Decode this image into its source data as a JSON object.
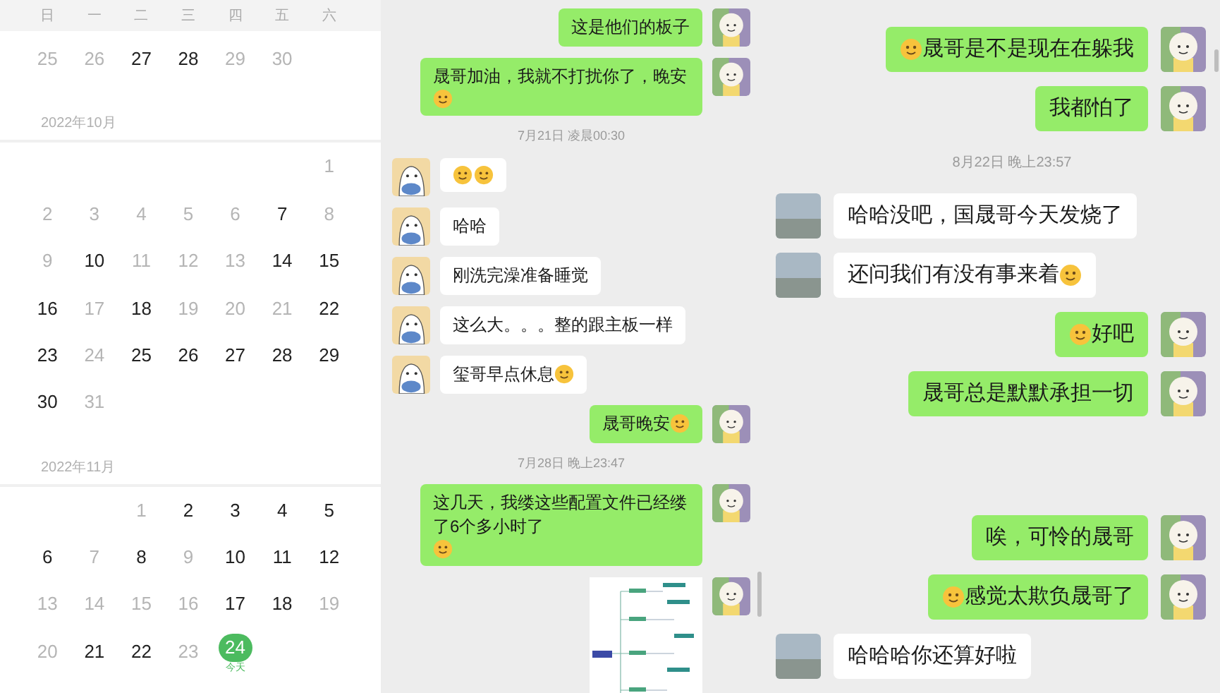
{
  "calendar": {
    "weekdays": [
      "日",
      "一",
      "二",
      "三",
      "四",
      "五",
      "六"
    ],
    "months": [
      {
        "days": [
          {
            "kind": "day",
            "text": "25",
            "active": false,
            "today": false
          },
          {
            "kind": "day",
            "text": "26",
            "active": false,
            "today": false
          },
          {
            "kind": "day",
            "text": "27",
            "active": true,
            "today": false
          },
          {
            "kind": "day",
            "text": "28",
            "active": true,
            "today": false
          },
          {
            "kind": "day",
            "text": "29",
            "active": false,
            "today": false
          },
          {
            "kind": "day",
            "text": "30",
            "active": false,
            "today": false
          }
        ]
      },
      {
        "title": "2022年10月",
        "days": [
          {
            "kind": "blank"
          },
          {
            "kind": "blank"
          },
          {
            "kind": "blank"
          },
          {
            "kind": "blank"
          },
          {
            "kind": "blank"
          },
          {
            "kind": "blank"
          },
          {
            "kind": "day",
            "text": "1",
            "active": false,
            "today": false
          },
          {
            "kind": "day",
            "text": "2",
            "active": false,
            "today": false
          },
          {
            "kind": "day",
            "text": "3",
            "active": false,
            "today": false
          },
          {
            "kind": "day",
            "text": "4",
            "active": false,
            "today": false
          },
          {
            "kind": "day",
            "text": "5",
            "active": false,
            "today": false
          },
          {
            "kind": "day",
            "text": "6",
            "active": false,
            "today": false
          },
          {
            "kind": "day",
            "text": "7",
            "active": true,
            "today": false
          },
          {
            "kind": "day",
            "text": "8",
            "active": false,
            "today": false
          },
          {
            "kind": "day",
            "text": "9",
            "active": false,
            "today": false
          },
          {
            "kind": "day",
            "text": "10",
            "active": true,
            "today": false
          },
          {
            "kind": "day",
            "text": "11",
            "active": false,
            "today": false
          },
          {
            "kind": "day",
            "text": "12",
            "active": false,
            "today": false
          },
          {
            "kind": "day",
            "text": "13",
            "active": false,
            "today": false
          },
          {
            "kind": "day",
            "text": "14",
            "active": true,
            "today": false
          },
          {
            "kind": "day",
            "text": "15",
            "active": true,
            "today": false
          },
          {
            "kind": "day",
            "text": "16",
            "active": true,
            "today": false
          },
          {
            "kind": "day",
            "text": "17",
            "active": false,
            "today": false
          },
          {
            "kind": "day",
            "text": "18",
            "active": true,
            "today": false
          },
          {
            "kind": "day",
            "text": "19",
            "active": false,
            "today": false
          },
          {
            "kind": "day",
            "text": "20",
            "active": false,
            "today": false
          },
          {
            "kind": "day",
            "text": "21",
            "active": false,
            "today": false
          },
          {
            "kind": "day",
            "text": "22",
            "active": true,
            "today": false
          },
          {
            "kind": "day",
            "text": "23",
            "active": true,
            "today": false
          },
          {
            "kind": "day",
            "text": "24",
            "active": false,
            "today": false
          },
          {
            "kind": "day",
            "text": "25",
            "active": true,
            "today": false
          },
          {
            "kind": "day",
            "text": "26",
            "active": true,
            "today": false
          },
          {
            "kind": "day",
            "text": "27",
            "active": true,
            "today": false
          },
          {
            "kind": "day",
            "text": "28",
            "active": true,
            "today": false
          },
          {
            "kind": "day",
            "text": "29",
            "active": true,
            "today": false
          },
          {
            "kind": "day",
            "text": "30",
            "active": true,
            "today": false
          },
          {
            "kind": "day",
            "text": "31",
            "active": false,
            "today": false
          }
        ]
      },
      {
        "title": "2022年11月",
        "days": [
          {
            "kind": "blank"
          },
          {
            "kind": "blank"
          },
          {
            "kind": "day",
            "text": "1",
            "active": false,
            "today": false
          },
          {
            "kind": "day",
            "text": "2",
            "active": true,
            "today": false
          },
          {
            "kind": "day",
            "text": "3",
            "active": true,
            "today": false
          },
          {
            "kind": "day",
            "text": "4",
            "active": true,
            "today": false
          },
          {
            "kind": "day",
            "text": "5",
            "active": true,
            "today": false
          },
          {
            "kind": "day",
            "text": "6",
            "active": true,
            "today": false
          },
          {
            "kind": "day",
            "text": "7",
            "active": false,
            "today": false
          },
          {
            "kind": "day",
            "text": "8",
            "active": true,
            "today": false
          },
          {
            "kind": "day",
            "text": "9",
            "active": false,
            "today": false
          },
          {
            "kind": "day",
            "text": "10",
            "active": true,
            "today": false
          },
          {
            "kind": "day",
            "text": "11",
            "active": true,
            "today": false
          },
          {
            "kind": "day",
            "text": "12",
            "active": true,
            "today": false
          },
          {
            "kind": "day",
            "text": "13",
            "active": false,
            "today": false
          },
          {
            "kind": "day",
            "text": "14",
            "active": false,
            "today": false
          },
          {
            "kind": "day",
            "text": "15",
            "active": false,
            "today": false
          },
          {
            "kind": "day",
            "text": "16",
            "active": false,
            "today": false
          },
          {
            "kind": "day",
            "text": "17",
            "active": true,
            "today": false
          },
          {
            "kind": "day",
            "text": "18",
            "active": true,
            "today": false
          },
          {
            "kind": "day",
            "text": "19",
            "active": false,
            "today": false
          },
          {
            "kind": "day",
            "text": "20",
            "active": false,
            "today": false
          },
          {
            "kind": "day",
            "text": "21",
            "active": true,
            "today": false
          },
          {
            "kind": "day",
            "text": "22",
            "active": true,
            "today": false
          },
          {
            "kind": "day",
            "text": "23",
            "active": false,
            "today": false
          },
          {
            "kind": "day",
            "text": "24",
            "active": true,
            "today": true,
            "note": "今天"
          }
        ]
      }
    ]
  },
  "chats": [
    {
      "kind": "cartoon",
      "items": [
        {
          "kind": "message",
          "outgoing": true,
          "emoji_before": false,
          "emoji_after": false,
          "text": "这是他们的板子"
        },
        {
          "kind": "message",
          "outgoing": true,
          "emoji_before": false,
          "emoji_after": true,
          "text": "晟哥加油，我就不打扰你了，晚安"
        },
        {
          "kind": "time",
          "text": "7月21日 凌晨00:30"
        },
        {
          "kind": "emoji_pair",
          "outgoing": false
        },
        {
          "kind": "message",
          "outgoing": false,
          "emoji_before": false,
          "emoji_after": false,
          "text": "哈哈"
        },
        {
          "kind": "message",
          "outgoing": false,
          "emoji_before": false,
          "emoji_after": false,
          "text": "刚洗完澡准备睡觉"
        },
        {
          "kind": "message",
          "outgoing": false,
          "emoji_before": false,
          "emoji_after": false,
          "text": "这么大。。。整的跟主板一样"
        },
        {
          "kind": "message",
          "outgoing": false,
          "emoji_before": false,
          "emoji_after": true,
          "text": "玺哥早点休息"
        },
        {
          "kind": "message",
          "outgoing": true,
          "emoji_before": false,
          "emoji_after": true,
          "text": "晟哥晚安"
        },
        {
          "kind": "time",
          "text": "7月28日 晚上23:47"
        },
        {
          "kind": "message",
          "outgoing": true,
          "emoji_before": false,
          "emoji_after": true,
          "text": "这几天，我缕这些配置文件已经缕了6个多小时了"
        },
        {
          "kind": "image",
          "outgoing": true
        }
      ]
    },
    {
      "kind": "photo",
      "items": [
        {
          "kind": "message",
          "outgoing": true,
          "emoji_before": true,
          "emoji_after": false,
          "text": "晟哥是不是现在在躲我"
        },
        {
          "kind": "message",
          "outgoing": true,
          "emoji_before": false,
          "emoji_after": false,
          "text": "我都怕了"
        },
        {
          "kind": "time",
          "text": "8月22日 晚上23:57"
        },
        {
          "kind": "message",
          "outgoing": false,
          "emoji_before": false,
          "emoji_after": false,
          "text": "哈哈没吧，国晟哥今天发烧了"
        },
        {
          "kind": "message",
          "outgoing": false,
          "emoji_before": false,
          "emoji_after": true,
          "text": "还问我们有没有事来着"
        },
        {
          "kind": "message",
          "outgoing": true,
          "emoji_before": true,
          "emoji_after": false,
          "text": "好吧"
        },
        {
          "kind": "message",
          "outgoing": true,
          "emoji_before": false,
          "emoji_after": false,
          "text": "晟哥总是默默承担一切"
        },
        {
          "kind": "message",
          "outgoing": true,
          "emoji_before": false,
          "emoji_after": false,
          "gap_before": true,
          "text": "唉，可怜的晟哥"
        },
        {
          "kind": "message",
          "outgoing": true,
          "emoji_before": true,
          "emoji_after": false,
          "text": "感觉太欺负晟哥了"
        },
        {
          "kind": "message",
          "outgoing": false,
          "emoji_before": false,
          "emoji_after": false,
          "text": "哈哈哈你还算好啦"
        }
      ]
    }
  ]
}
